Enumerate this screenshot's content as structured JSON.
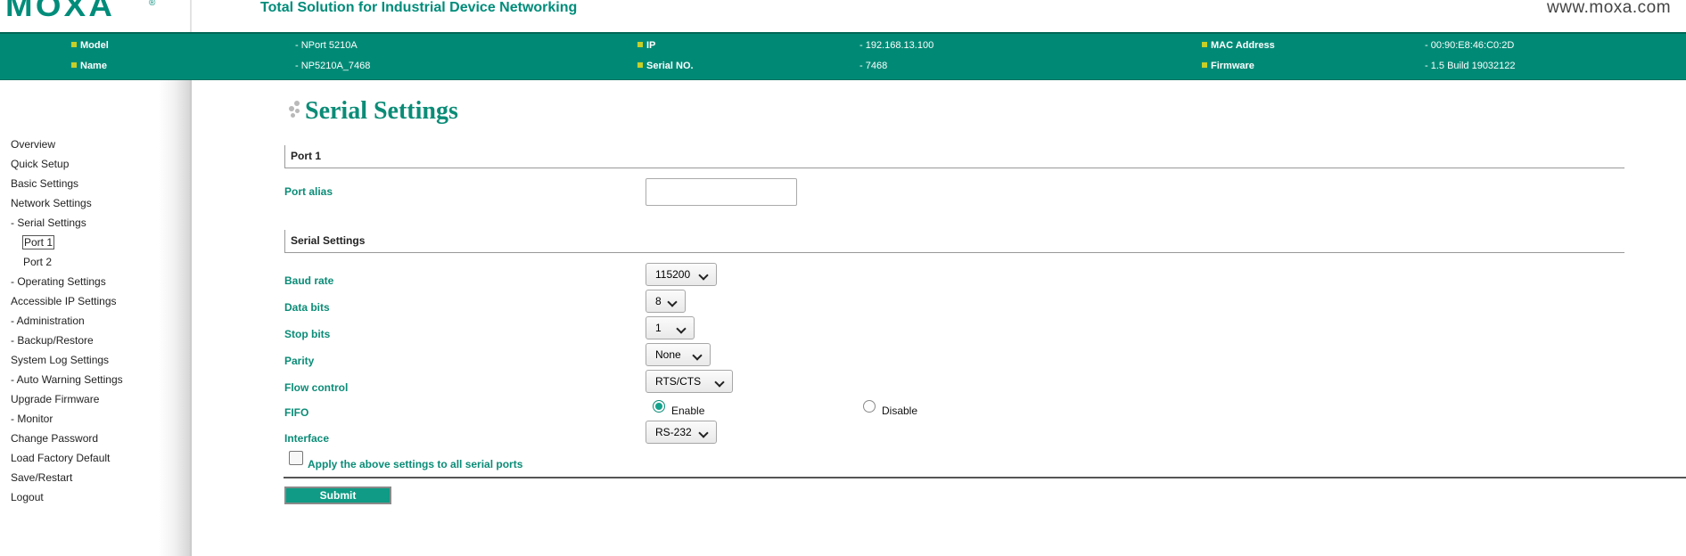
{
  "header": {
    "logo_text": "MOXA",
    "logo_reg": "®",
    "tagline": "Total Solution for Industrial Device Networking",
    "website": "www.moxa.com"
  },
  "device_info": {
    "model_label": "Model",
    "model_value": "- NPort 5210A",
    "name_label": "Name",
    "name_value": "- NP5210A_7468",
    "ip_label": "IP",
    "ip_value": "- 192.168.13.100",
    "serial_label": "Serial NO.",
    "serial_value": "- 7468",
    "mac_label": "MAC Address",
    "mac_value": "- 00:90:E8:46:C0:2D",
    "firmware_label": "Firmware",
    "firmware_value": "- 1.5 Build 19032122"
  },
  "sidebar": {
    "items": [
      {
        "label": "Overview"
      },
      {
        "label": "Quick Setup"
      },
      {
        "label": "Basic Settings"
      },
      {
        "label": "Network Settings"
      },
      {
        "label": "- Serial Settings"
      },
      {
        "label": "Port 1"
      },
      {
        "label": "Port 2"
      },
      {
        "label": "- Operating Settings"
      },
      {
        "label": "Accessible IP Settings"
      },
      {
        "label": "- Administration"
      },
      {
        "label": "- Backup/Restore"
      },
      {
        "label": "System Log Settings"
      },
      {
        "label": "- Auto Warning Settings"
      },
      {
        "label": "Upgrade Firmware"
      },
      {
        "label": "- Monitor"
      },
      {
        "label": "Change Password"
      },
      {
        "label": "Load Factory Default"
      },
      {
        "label": "Save/Restart"
      },
      {
        "label": "Logout"
      }
    ]
  },
  "main": {
    "title": "Serial Settings",
    "port_section": "Port 1",
    "port_alias_label": "Port alias",
    "port_alias_value": "",
    "serial_section": "Serial Settings",
    "baud_rate_label": "Baud rate",
    "baud_rate_value": "115200",
    "data_bits_label": "Data bits",
    "data_bits_value": "8",
    "stop_bits_label": "Stop bits",
    "stop_bits_value": "1",
    "parity_label": "Parity",
    "parity_value": "None",
    "flow_control_label": "Flow control",
    "flow_control_value": "RTS/CTS",
    "fifo_label": "FIFO",
    "fifo_enable_label": "Enable",
    "fifo_disable_label": "Disable",
    "fifo_selected": "Enable",
    "interface_label": "Interface",
    "interface_value": "RS-232",
    "apply_all_label": "Apply the above settings to all serial ports",
    "apply_all_checked": false,
    "submit_label": "Submit"
  },
  "colors": {
    "brand_teal": "#008a76",
    "label_teal": "#0b8c77",
    "bullet_yellow": "#c6cf28",
    "button_teal": "#0f9b85"
  }
}
